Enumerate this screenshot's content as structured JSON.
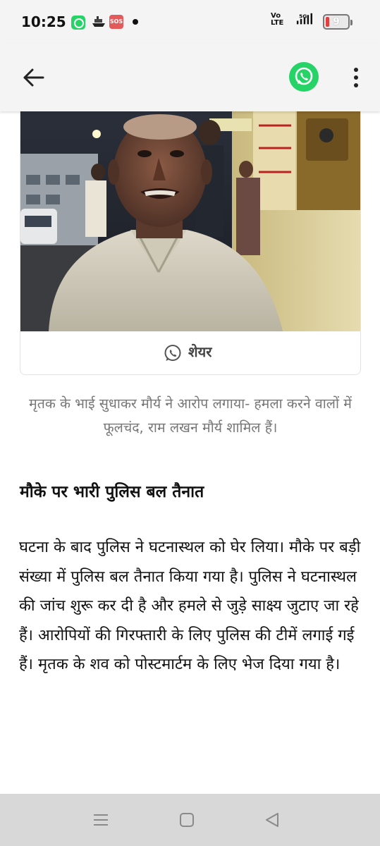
{
  "status_bar": {
    "time": "10:25",
    "sos": "SOS",
    "network_type": "Vo LTE",
    "network_gen": "5G",
    "battery_level": "9"
  },
  "app_bar": {
    "back_icon": "back-arrow-icon",
    "share_icon": "whatsapp-icon",
    "menu_icon": "more-vertical-icon"
  },
  "article": {
    "share_label": "शेयर",
    "caption": "मृतक के भाई सुधाकर मौर्य ने आरोप लगाया- हमला करने वालों में फूलचंद, राम लखन मौर्य शामिल हैं।",
    "subheading": "मौके पर भारी पुलिस बल तैनात",
    "body": "घटना के बाद पुलिस ने घटनास्थल को घेर लिया। मौके पर बड़ी संख्या में पुलिस बल तैनात किया गया है। पुलिस ने घटनास्थल की जांच शुरू कर दी है और हमले से जुड़े साक्ष्य जुटाए जा रहे हैं। आरोपियों की गिरफ्तारी के लिए पुलिस की टीमें लगाई गई हैं। मृतक के शव को पोस्टमार्टम के लिए भेज दिया गया है।"
  },
  "colors": {
    "whatsapp_green": "#25d366",
    "caption_gray": "#777777",
    "nav_bar": "#d8d8d8"
  }
}
